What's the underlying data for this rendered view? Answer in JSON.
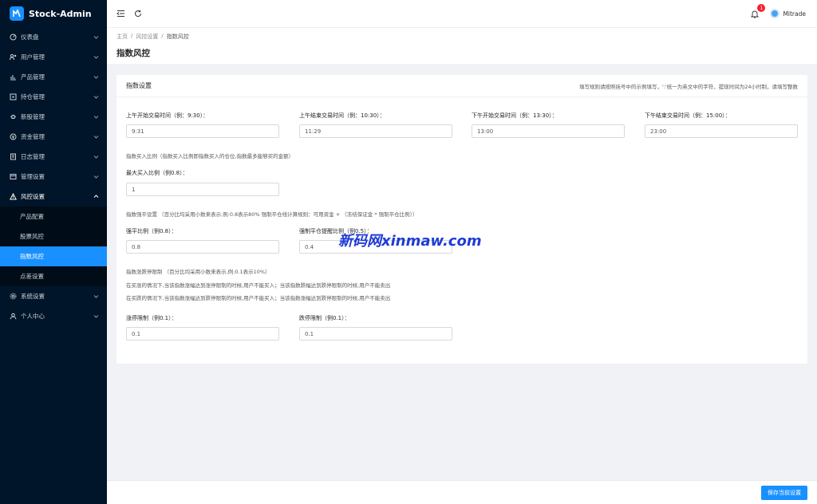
{
  "brand": {
    "name": "Stock-Admin"
  },
  "sidebar": {
    "items": [
      {
        "label": "仪表盘",
        "icon": "dashboard-icon"
      },
      {
        "label": "用户管理",
        "icon": "users-icon"
      },
      {
        "label": "产品管理",
        "icon": "chart-bar-icon"
      },
      {
        "label": "持仓管理",
        "icon": "position-icon"
      },
      {
        "label": "新股管理",
        "icon": "new-stock-icon"
      },
      {
        "label": "资金管理",
        "icon": "money-icon"
      },
      {
        "label": "日志管理",
        "icon": "log-icon"
      },
      {
        "label": "管理设置",
        "icon": "settings-icon"
      },
      {
        "label": "风控设置",
        "icon": "warning-icon"
      }
    ],
    "submenu": [
      {
        "label": "产品配置"
      },
      {
        "label": "股票风控"
      },
      {
        "label": "指数风控"
      },
      {
        "label": "点差设置"
      }
    ],
    "bottom_items": [
      {
        "label": "系统设置",
        "icon": "gear-icon"
      },
      {
        "label": "个人中心",
        "icon": "user-icon"
      }
    ]
  },
  "header": {
    "notification_count": "1",
    "username": "Mitrade"
  },
  "breadcrumb": {
    "home": "主页",
    "sep": "/",
    "parent": "风控设置",
    "current": "指数风控"
  },
  "page_title": "指数风控",
  "card": {
    "title": "指数设置",
    "hint": "填写规则请按照括号中的示例填写，':'统一为英文中的字符，提现时间为24小时制，请填写整数",
    "fields": {
      "am_start": {
        "label": "上午开始交易时间（例：9:30）：",
        "value": "9:31"
      },
      "am_end": {
        "label": "上午结束交易时间（例：10:30）：",
        "value": "11:29"
      },
      "pm_start": {
        "label": "下午开始交易时间（例：13:30）：",
        "value": "13:00"
      },
      "pm_end": {
        "label": "下午结束交易时间（例：15:00）：",
        "value": "23:00"
      },
      "max_buy": {
        "label": "最大买入比例（例0.8）：",
        "value": "1"
      },
      "force_close": {
        "label": "强平比例（例0.8）：",
        "value": "0.8"
      },
      "force_warn": {
        "label": "强制平仓提醒比例（例0.5）：",
        "value": "0.4"
      },
      "limit_up": {
        "label": "涨停限制（例0.1）：",
        "value": "0.1"
      },
      "limit_down": {
        "label": "跌停限制（例0.1）：",
        "value": "0.1"
      }
    },
    "notes": {
      "buy_ratio": "指数买入比例（指数买入比例即指数买入的仓位,指数最多能够买的金额）",
      "force_setting": "指数强平设置 （百分比均采用小数来表示,例:0.8表示80% 强制平仓线计算规则：可用资金 + （冻结保证金 * 强制平仓比例））",
      "limit_setting": "指数涨跌停限制 （百分比均采用小数来表示,例:0.1表示10%）",
      "rule_buy": "在买涨的情况下,当该指数涨幅达到涨停限制的时候,用户不能买入；当该指数跌幅达到跌停限制的时候,用户不能卖出",
      "rule_sell": "在买跌的情况下,当该指数涨幅达到跌停限制的时候,用户不能买入；当该指数涨幅达到跌停限制的时候,用户不能卖出"
    }
  },
  "footer": {
    "save_label": "保存当前设置"
  },
  "watermark": "新码网xinmaw.com",
  "colors": {
    "sidebar_bg": "#001529",
    "accent": "#1890ff",
    "badge": "#f5222d"
  }
}
